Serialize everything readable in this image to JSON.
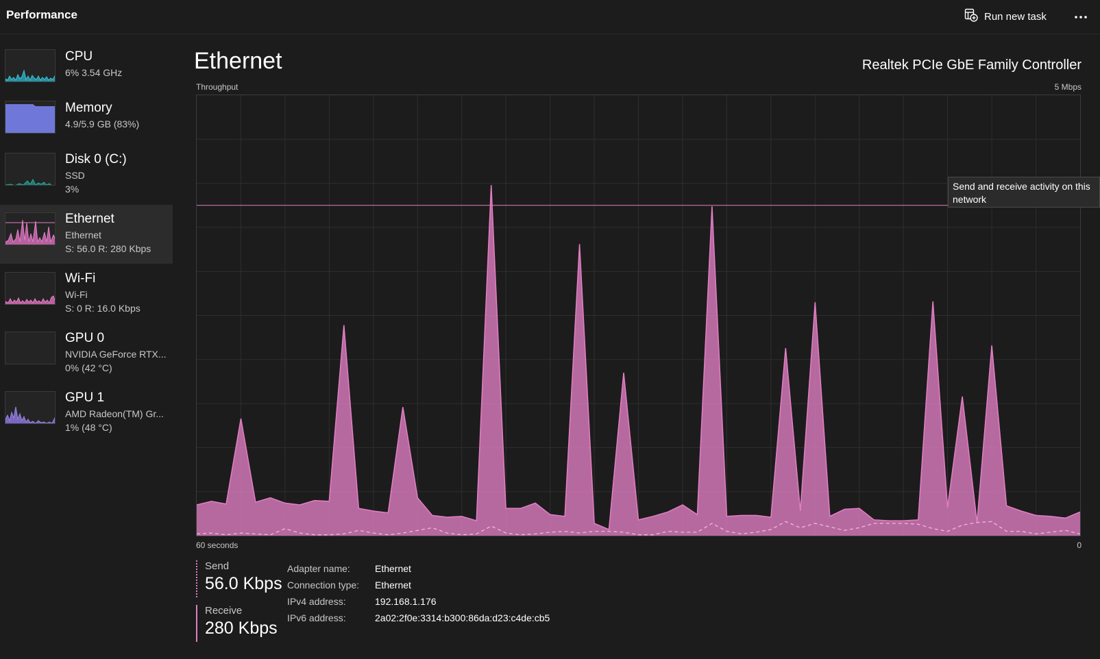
{
  "header": {
    "title": "Performance",
    "run_new_task": "Run new task"
  },
  "sidebar": {
    "items": [
      {
        "name": "CPU",
        "line1": "6%  3.54 GHz",
        "line2": ""
      },
      {
        "name": "Memory",
        "line1": "4.9/5.9 GB (83%)",
        "line2": ""
      },
      {
        "name": "Disk 0 (C:)",
        "line1": "SSD",
        "line2": "3%"
      },
      {
        "name": "Ethernet",
        "line1": "Ethernet",
        "line2": "S: 56.0  R: 280 Kbps"
      },
      {
        "name": "Wi-Fi",
        "line1": "Wi-Fi",
        "line2": "S: 0  R: 16.0 Kbps"
      },
      {
        "name": "GPU 0",
        "line1": "NVIDIA GeForce RTX...",
        "line2": "0%  (42 °C)"
      },
      {
        "name": "GPU 1",
        "line1": "AMD Radeon(TM) Gr...",
        "line2": "1%  (48 °C)"
      }
    ],
    "selected_index": 3
  },
  "main": {
    "title": "Ethernet",
    "adapter_description": "Realtek PCIe GbE Family Controller",
    "graph": {
      "y_label": "Throughput",
      "y_max_label": "5 Mbps",
      "x_left_label": "60 seconds",
      "x_right_label": "0",
      "tooltip": "Send and receive activity on this network"
    },
    "send": {
      "label": "Send",
      "value": "56.0 Kbps"
    },
    "receive": {
      "label": "Receive",
      "value": "280 Kbps"
    },
    "details": [
      {
        "key": "Adapter name:",
        "value": "Ethernet"
      },
      {
        "key": "Connection type:",
        "value": "Ethernet"
      },
      {
        "key": "IPv4 address:",
        "value": "192.168.1.176"
      },
      {
        "key": "IPv6 address:",
        "value": "2a02:2f0e:3314:b300:86da:d23:c4de:cb5"
      }
    ]
  },
  "colors": {
    "accent_pink": "#e27fc4",
    "cpu": "#38c8d8",
    "memory": "#6f78d8",
    "disk": "#2aa8a0",
    "gpu1": "#9b86e0"
  },
  "chart_data": {
    "type": "area",
    "x": [
      60,
      59,
      58,
      57,
      56,
      55,
      54,
      53,
      52,
      51,
      50,
      49,
      48,
      47,
      46,
      45,
      44,
      43,
      42,
      41,
      40,
      39,
      38,
      37,
      36,
      35,
      34,
      33,
      32,
      31,
      30,
      29,
      28,
      27,
      26,
      25,
      24,
      23,
      22,
      21,
      20,
      19,
      18,
      17,
      16,
      15,
      14,
      13,
      12,
      11,
      10,
      9,
      8,
      7,
      6,
      5,
      4,
      3,
      2,
      1,
      0
    ],
    "y_range_mbps": [
      0,
      5
    ],
    "gridlines": {
      "vertical": 20,
      "horizontal": 10
    },
    "scale_line_mbps": 3.75,
    "series": [
      {
        "name": "Receive",
        "style": "solid",
        "values": [
          0.35,
          0.39,
          0.36,
          1.33,
          0.38,
          0.43,
          0.37,
          0.35,
          0.4,
          0.39,
          2.39,
          0.31,
          0.28,
          0.26,
          1.46,
          0.43,
          0.23,
          0.21,
          0.22,
          0.17,
          3.98,
          0.31,
          0.31,
          0.37,
          0.24,
          0.22,
          3.31,
          0.14,
          0.07,
          1.85,
          0.18,
          0.22,
          0.27,
          0.35,
          0.24,
          3.74,
          0.22,
          0.23,
          0.23,
          0.21,
          2.13,
          0.28,
          2.65,
          0.22,
          0.3,
          0.31,
          0.18,
          0.17,
          0.17,
          0.18,
          2.66,
          0.32,
          1.58,
          0.15,
          2.16,
          0.34,
          0.28,
          0.23,
          0.22,
          0.2,
          0.27
        ]
      },
      {
        "name": "Send",
        "style": "dashed",
        "values": [
          0.02,
          0.03,
          0.01,
          0.03,
          0.02,
          0.01,
          0.08,
          0.03,
          0.01,
          0.01,
          0.02,
          0.06,
          0.03,
          0.01,
          0.03,
          0.06,
          0.09,
          0.03,
          0.01,
          0.02,
          0.11,
          0.03,
          0.01,
          0.02,
          0.04,
          0.05,
          0.03,
          0.05,
          0.05,
          0.04,
          0.01,
          0.01,
          0.05,
          0.04,
          0.04,
          0.14,
          0.05,
          0.02,
          0.04,
          0.07,
          0.16,
          0.09,
          0.14,
          0.1,
          0.06,
          0.09,
          0.14,
          0.14,
          0.14,
          0.13,
          0.08,
          0.05,
          0.12,
          0.15,
          0.16,
          0.05,
          0.05,
          0.02,
          0.04,
          0.06,
          0.02
        ]
      }
    ]
  }
}
